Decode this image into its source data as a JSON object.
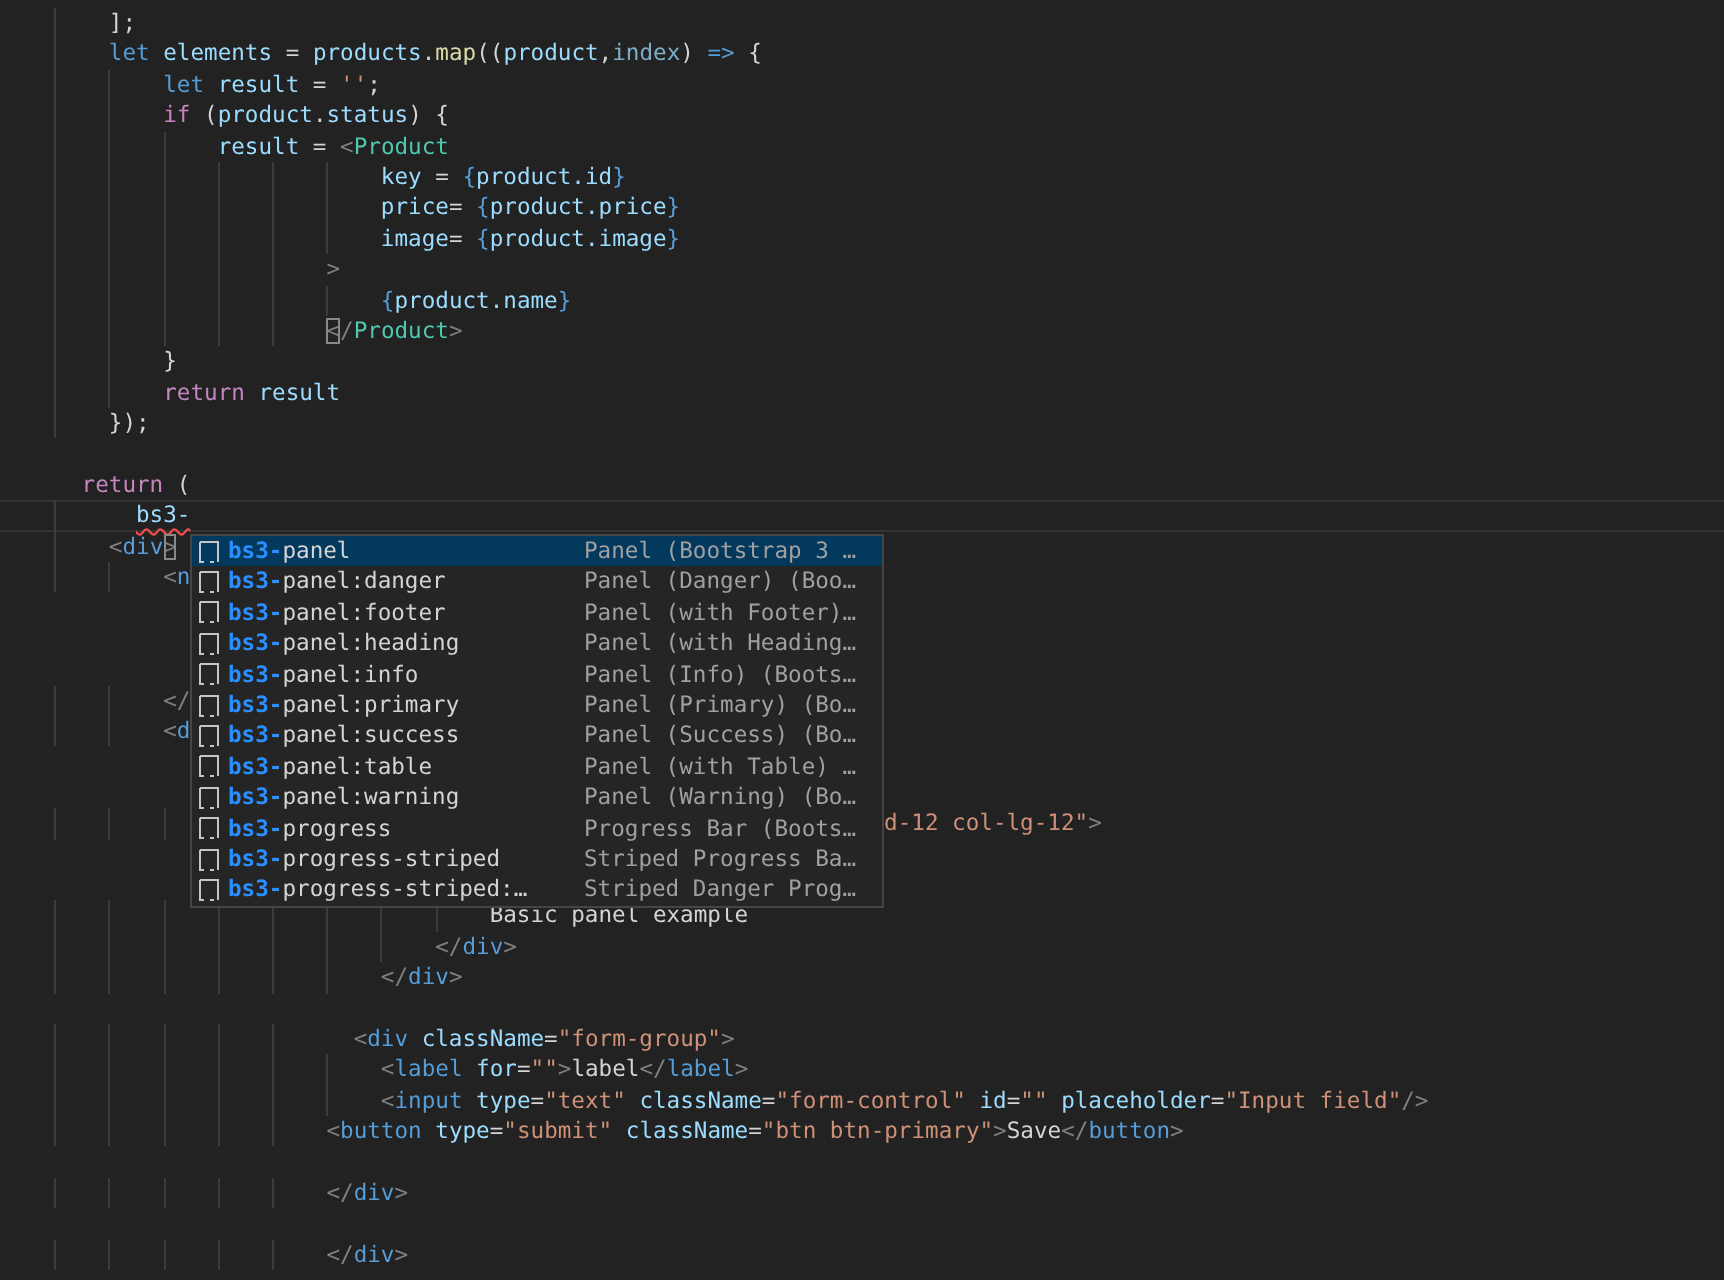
{
  "editor": {
    "lines": [
      {
        "kind": "code",
        "tokens": [
          {
            "kind": "plain",
            "text": "        ];"
          }
        ]
      },
      {
        "kind": "code",
        "tokens": [
          {
            "kind": "decl",
            "text": "        let"
          },
          {
            "kind": "var",
            "text": " elements"
          },
          {
            "kind": "plain",
            "text": " = "
          },
          {
            "kind": "var",
            "text": "products"
          },
          {
            "kind": "plain",
            "text": "."
          },
          {
            "kind": "fn",
            "text": "map"
          },
          {
            "kind": "plain",
            "text": "(("
          },
          {
            "kind": "var",
            "text": "product"
          },
          {
            "kind": "plain",
            "text": ","
          },
          {
            "kind": "param",
            "text": "index"
          },
          {
            "kind": "plain",
            "text": ") "
          },
          {
            "kind": "decl",
            "text": "=>"
          },
          {
            "kind": "plain",
            "text": " {"
          }
        ]
      },
      {
        "kind": "code",
        "tokens": [
          {
            "kind": "decl",
            "text": "            let"
          },
          {
            "kind": "var",
            "text": " result"
          },
          {
            "kind": "plain",
            "text": " = "
          },
          {
            "kind": "str",
            "text": "''"
          },
          {
            "kind": "plain",
            "text": ";"
          }
        ]
      },
      {
        "kind": "code",
        "tokens": [
          {
            "kind": "ctl",
            "text": "            if"
          },
          {
            "kind": "plain",
            "text": " ("
          },
          {
            "kind": "var",
            "text": "product"
          },
          {
            "kind": "plain",
            "text": "."
          },
          {
            "kind": "var",
            "text": "status"
          },
          {
            "kind": "plain",
            "text": ") {"
          }
        ]
      },
      {
        "kind": "code",
        "tokens": [
          {
            "kind": "var",
            "text": "                result"
          },
          {
            "kind": "plain",
            "text": " = "
          },
          {
            "kind": "punct",
            "text": "<"
          },
          {
            "kind": "comp",
            "text": "Product"
          }
        ]
      },
      {
        "kind": "code",
        "tokens": [
          {
            "kind": "attr",
            "text": "                            key"
          },
          {
            "kind": "plain",
            "text": " = "
          },
          {
            "kind": "brace",
            "text": "{"
          },
          {
            "kind": "var",
            "text": "product.id"
          },
          {
            "kind": "brace",
            "text": "}"
          }
        ]
      },
      {
        "kind": "code",
        "tokens": [
          {
            "kind": "attr",
            "text": "                            price"
          },
          {
            "kind": "plain",
            "text": "= "
          },
          {
            "kind": "brace",
            "text": "{"
          },
          {
            "kind": "var",
            "text": "product.price"
          },
          {
            "kind": "brace",
            "text": "}"
          }
        ]
      },
      {
        "kind": "code",
        "tokens": [
          {
            "kind": "attr",
            "text": "                            image"
          },
          {
            "kind": "plain",
            "text": "= "
          },
          {
            "kind": "brace",
            "text": "{"
          },
          {
            "kind": "var",
            "text": "product.image"
          },
          {
            "kind": "brace",
            "text": "}"
          }
        ]
      },
      {
        "kind": "code",
        "tokens": [
          {
            "kind": "punct",
            "text": "                        >"
          }
        ]
      },
      {
        "kind": "code",
        "tokens": [
          {
            "kind": "brace",
            "text": "                            {"
          },
          {
            "kind": "var",
            "text": "product.name"
          },
          {
            "kind": "brace",
            "text": "}"
          }
        ]
      },
      {
        "kind": "code",
        "tokens": [
          {
            "kind": "match",
            "text": "                        <"
          },
          {
            "kind": "punct",
            "text": "/"
          },
          {
            "kind": "comp",
            "text": "Product"
          },
          {
            "kind": "punct",
            "text": ">"
          }
        ]
      },
      {
        "kind": "code",
        "tokens": [
          {
            "kind": "plain",
            "text": "            }"
          }
        ]
      },
      {
        "kind": "code",
        "tokens": [
          {
            "kind": "ctl",
            "text": "            return"
          },
          {
            "kind": "var",
            "text": " result"
          }
        ]
      },
      {
        "kind": "code",
        "tokens": [
          {
            "kind": "plain",
            "text": "        });"
          }
        ]
      },
      {
        "kind": "blank"
      },
      {
        "kind": "code",
        "tokens": [
          {
            "kind": "ctl",
            "text": "      return"
          },
          {
            "kind": "plain",
            "text": " ("
          }
        ]
      },
      {
        "kind": "code",
        "current": true,
        "tokens": [
          {
            "kind": "error",
            "text": "          bs3-"
          }
        ]
      },
      {
        "kind": "code",
        "tokens": [
          {
            "kind": "punct",
            "text": "        <"
          },
          {
            "kind": "tag",
            "text": "div"
          },
          {
            "kind": "match",
            "text": ">"
          }
        ]
      },
      {
        "kind": "code",
        "tokens": [
          {
            "kind": "punct",
            "text": "            <"
          },
          {
            "kind": "tag",
            "text": "n"
          }
        ]
      },
      {
        "kind": "blank"
      },
      {
        "kind": "blank"
      },
      {
        "kind": "blank"
      },
      {
        "kind": "code",
        "tokens": [
          {
            "kind": "punct",
            "text": "            </"
          }
        ]
      },
      {
        "kind": "code",
        "tokens": [
          {
            "kind": "punct",
            "text": "            <"
          },
          {
            "kind": "tag",
            "text": "d"
          }
        ]
      },
      {
        "kind": "blank"
      },
      {
        "kind": "blank"
      },
      {
        "kind": "code",
        "tokens": [
          {
            "kind": "str",
            "text": "                                                                 d-12 col-lg-12\""
          },
          {
            "kind": "punct",
            "text": ">"
          }
        ]
      },
      {
        "kind": "blank"
      },
      {
        "kind": "blank"
      },
      {
        "kind": "code",
        "tokens": [
          {
            "kind": "plain",
            "text": "                                    Basic panel example"
          }
        ]
      },
      {
        "kind": "code",
        "tokens": [
          {
            "kind": "punct",
            "text": "                                </"
          },
          {
            "kind": "tag",
            "text": "div"
          },
          {
            "kind": "punct",
            "text": ">"
          }
        ]
      },
      {
        "kind": "code",
        "tokens": [
          {
            "kind": "punct",
            "text": "                            </"
          },
          {
            "kind": "tag",
            "text": "div"
          },
          {
            "kind": "punct",
            "text": ">"
          }
        ]
      },
      {
        "kind": "blank"
      },
      {
        "kind": "code",
        "tokens": [
          {
            "kind": "punct",
            "text": "                          <"
          },
          {
            "kind": "tag",
            "text": "div"
          },
          {
            "kind": "attr",
            "text": " className"
          },
          {
            "kind": "plain",
            "text": "="
          },
          {
            "kind": "str",
            "text": "\"form-group\""
          },
          {
            "kind": "punct",
            "text": ">"
          }
        ]
      },
      {
        "kind": "code",
        "tokens": [
          {
            "kind": "punct",
            "text": "                            <"
          },
          {
            "kind": "tag",
            "text": "label"
          },
          {
            "kind": "attr",
            "text": " for"
          },
          {
            "kind": "plain",
            "text": "="
          },
          {
            "kind": "str",
            "text": "\"\""
          },
          {
            "kind": "punct",
            "text": ">"
          },
          {
            "kind": "plain",
            "text": "label"
          },
          {
            "kind": "punct",
            "text": "</"
          },
          {
            "kind": "tag",
            "text": "label"
          },
          {
            "kind": "punct",
            "text": ">"
          }
        ]
      },
      {
        "kind": "code",
        "tokens": [
          {
            "kind": "punct",
            "text": "                            <"
          },
          {
            "kind": "tag",
            "text": "input"
          },
          {
            "kind": "attr",
            "text": " type"
          },
          {
            "kind": "plain",
            "text": "="
          },
          {
            "kind": "str",
            "text": "\"text\""
          },
          {
            "kind": "attr",
            "text": " className"
          },
          {
            "kind": "plain",
            "text": "="
          },
          {
            "kind": "str",
            "text": "\"form-control\""
          },
          {
            "kind": "attr",
            "text": " id"
          },
          {
            "kind": "plain",
            "text": "="
          },
          {
            "kind": "str",
            "text": "\"\""
          },
          {
            "kind": "attr",
            "text": " placeholder"
          },
          {
            "kind": "plain",
            "text": "="
          },
          {
            "kind": "str",
            "text": "\"Input field\""
          },
          {
            "kind": "punct",
            "text": "/>"
          }
        ]
      },
      {
        "kind": "code",
        "tokens": [
          {
            "kind": "punct",
            "text": "                        <"
          },
          {
            "kind": "tag",
            "text": "button"
          },
          {
            "kind": "attr",
            "text": " type"
          },
          {
            "kind": "plain",
            "text": "="
          },
          {
            "kind": "str",
            "text": "\"submit\""
          },
          {
            "kind": "attr",
            "text": " className"
          },
          {
            "kind": "plain",
            "text": "="
          },
          {
            "kind": "str",
            "text": "\"btn btn-primary\""
          },
          {
            "kind": "punct",
            "text": ">"
          },
          {
            "kind": "plain",
            "text": "Save"
          },
          {
            "kind": "punct",
            "text": "</"
          },
          {
            "kind": "tag",
            "text": "button"
          },
          {
            "kind": "punct",
            "text": ">"
          }
        ]
      },
      {
        "kind": "blank"
      },
      {
        "kind": "code",
        "tokens": [
          {
            "kind": "punct",
            "text": "                        </"
          },
          {
            "kind": "tag",
            "text": "div"
          },
          {
            "kind": "punct",
            "text": ">"
          }
        ]
      },
      {
        "kind": "blank"
      },
      {
        "kind": "code",
        "tokens": [
          {
            "kind": "punct",
            "text": "                        </"
          },
          {
            "kind": "tag",
            "text": "div"
          },
          {
            "kind": "punct",
            "text": ">"
          }
        ]
      }
    ]
  },
  "suggestions": [
    {
      "match": "bs3-",
      "rest": "panel",
      "detail": "Panel (Bootstrap 3 …",
      "selected": true
    },
    {
      "match": "bs3-",
      "rest": "panel:danger",
      "detail": "Panel (Danger) (Boo…",
      "selected": false
    },
    {
      "match": "bs3-",
      "rest": "panel:footer",
      "detail": "Panel (with Footer)…",
      "selected": false
    },
    {
      "match": "bs3-",
      "rest": "panel:heading",
      "detail": "Panel (with Heading…",
      "selected": false
    },
    {
      "match": "bs3-",
      "rest": "panel:info",
      "detail": "Panel (Info) (Boots…",
      "selected": false
    },
    {
      "match": "bs3-",
      "rest": "panel:primary",
      "detail": "Panel (Primary) (Bo…",
      "selected": false
    },
    {
      "match": "bs3-",
      "rest": "panel:success",
      "detail": "Panel (Success) (Bo…",
      "selected": false
    },
    {
      "match": "bs3-",
      "rest": "panel:table",
      "detail": "Panel (with Table) …",
      "selected": false
    },
    {
      "match": "bs3-",
      "rest": "panel:warning",
      "detail": "Panel (Warning) (Bo…",
      "selected": false
    },
    {
      "match": "bs3-",
      "rest": "progress",
      "detail": "Progress Bar (Boots…",
      "selected": false
    },
    {
      "match": "bs3-",
      "rest": "progress-striped",
      "detail": "Striped Progress Ba…",
      "selected": false
    },
    {
      "match": "bs3-",
      "rest": "progress-striped:…",
      "detail": "Striped Danger Prog…",
      "selected": false
    }
  ]
}
